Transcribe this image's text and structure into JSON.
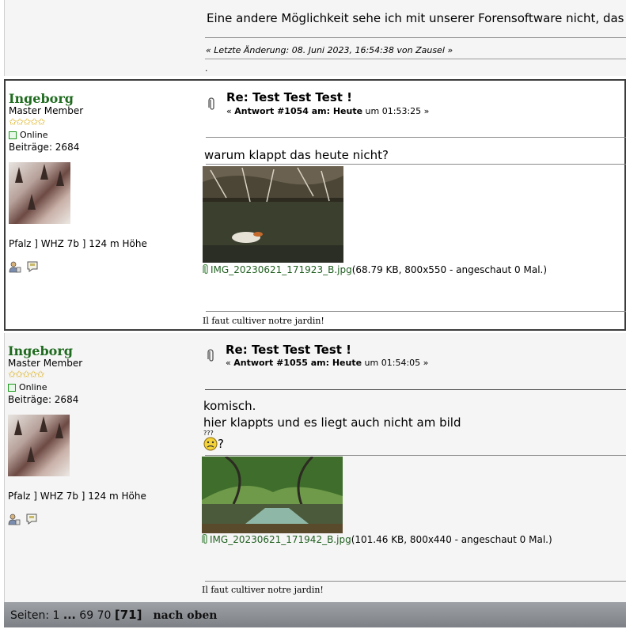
{
  "top_post": {
    "text": "Eine andere Möglichkeit sehe ich mit unserer Forensoftware nicht, das",
    "last_edit": "« Letzte Änderung: 08. Juni 2023, 16:54:38 von Zausel »",
    "dot": "."
  },
  "posts": [
    {
      "name": "Ingeborg",
      "rank": "Master Member",
      "stars": "✩✩✩✩✩",
      "status": "Online",
      "posts_count": "Beiträge: 2684",
      "location": "Pfalz ] WHZ 7b ] 124 m Höhe",
      "subject": "Re: Test Test Test !",
      "answer_prefix": "« ",
      "answer_bold": "Antwort #1054 am: Heute",
      "answer_time": " um 01:53:25 »",
      "body": [
        "warum klappt das heute nicht?"
      ],
      "attachment_name": "IMG_20230621_171923_B.jpg",
      "attachment_info": " (68.79 KB, 800x550 - angeschaut 0 Mal.)",
      "signature": "Il faut cultiver notre jardin!"
    },
    {
      "name": "Ingeborg",
      "rank": "Master Member",
      "stars": "✩✩✩✩✩",
      "status": "Online",
      "posts_count": "Beiträge: 2684",
      "location": "Pfalz ] WHZ 7b ] 124 m Höhe",
      "subject": "Re: Test Test Test !",
      "answer_prefix": "« ",
      "answer_bold": "Antwort #1055 am: Heute",
      "answer_time": " um 01:54:05 »",
      "body": [
        "komisch.",
        "hier klappts und es liegt auch nicht am bild"
      ],
      "smiley_label": "???",
      "smiley_suffix": "?",
      "attachment_name": "IMG_20230621_171942_B.jpg",
      "attachment_info": " (101.46 KB, 800x440 - angeschaut 0 Mal.)",
      "signature": "Il faut cultiver notre jardin!"
    }
  ],
  "pagination": {
    "label": "Seiten: 1 ",
    "ellipsis": "...",
    "pages": " 69 70 ",
    "current": "[71]",
    "top_link": "nach oben"
  },
  "icons": {
    "profile": "profile-icon",
    "message": "message-icon",
    "attachment": "paperclip-icon"
  }
}
